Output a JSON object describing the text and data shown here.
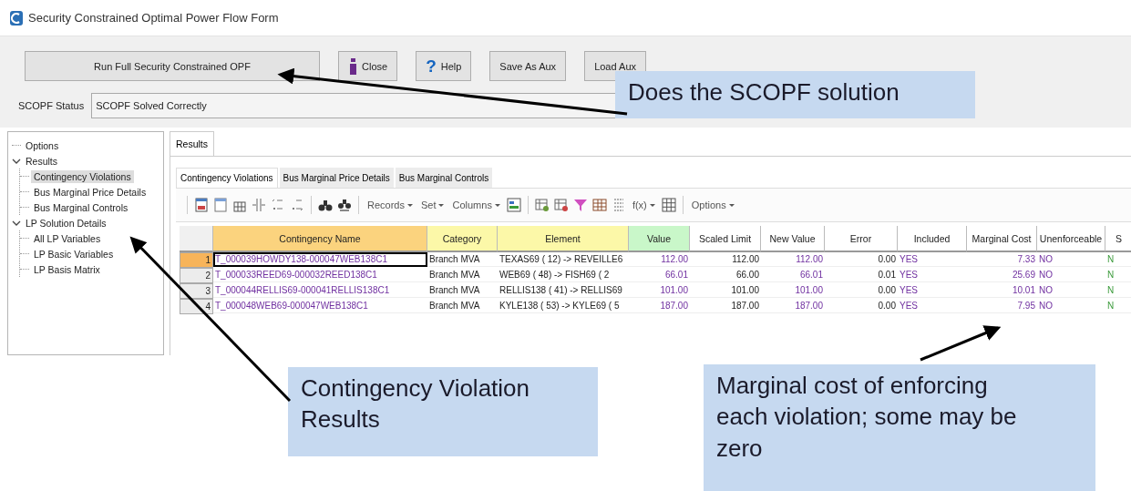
{
  "window": {
    "title": "Security Constrained Optimal Power Flow Form"
  },
  "command_bar": {
    "buttons": [
      {
        "label": "Run Full Security Constrained OPF",
        "kind": "wide"
      },
      {
        "label": "Close",
        "kind": "info"
      },
      {
        "label": "Help",
        "kind": "help",
        "glyph": "?"
      },
      {
        "label": "Save As Aux",
        "kind": "plain"
      },
      {
        "label": "Load Aux",
        "kind": "plain"
      }
    ],
    "status": {
      "label": "SCOPF Status",
      "value": "SCOPF Solved Correctly"
    }
  },
  "tree": {
    "items": [
      {
        "label": "Options",
        "selected": false
      },
      {
        "label": "Results",
        "selected": false,
        "expanded": true,
        "children": [
          {
            "label": "Contingency Violations",
            "selected": true
          },
          {
            "label": "Bus Marginal Price Details",
            "selected": false
          },
          {
            "label": "Bus Marginal Controls",
            "selected": false
          }
        ]
      },
      {
        "label": "LP Solution Details",
        "selected": false,
        "expanded": true,
        "children": [
          {
            "label": "All LP Variables",
            "selected": false
          },
          {
            "label": "LP Basic Variables",
            "selected": false
          },
          {
            "label": "LP Basis Matrix",
            "selected": false
          }
        ]
      }
    ]
  },
  "results": {
    "tabs": [
      {
        "label": "Results",
        "selected": true
      }
    ],
    "sub_tabs": [
      {
        "label": "Contingency Violations",
        "selected": true
      },
      {
        "label": "Bus Marginal Price Details",
        "selected": false
      },
      {
        "label": "Bus Marginal Controls",
        "selected": false
      }
    ],
    "toolbar": {
      "menus": [
        {
          "label": "Records"
        },
        {
          "label": "Set"
        },
        {
          "label": "Columns"
        }
      ],
      "formula_menu": {
        "label": "f(x)"
      },
      "options_menu": {
        "label": "Options"
      }
    },
    "table": {
      "columns": [
        {
          "kind": "index",
          "color": "#f0f0f0"
        },
        {
          "label": "Contingency Name",
          "kind": "name",
          "color": "#fbd37e"
        },
        {
          "label": "Category",
          "kind": "label",
          "color": "#fcf8a8"
        },
        {
          "label": "Element",
          "kind": "label",
          "color": "#fcf8a8"
        },
        {
          "label": "Value",
          "kind": "value",
          "color": "#c9f7c9"
        },
        {
          "label": "Scaled Limit",
          "kind": "number",
          "color": "#ffffff"
        },
        {
          "label": "New Value",
          "kind": "value",
          "color": "#ffffff"
        },
        {
          "label": "Error",
          "kind": "number",
          "color": "#ffffff"
        },
        {
          "label": "Included",
          "kind": "flag",
          "color": "#ffffff"
        },
        {
          "label": "Marginal Cost",
          "kind": "value",
          "color": "#ffffff"
        },
        {
          "label": "Unenforceable",
          "kind": "flag",
          "color": "#ffffff"
        },
        {
          "label": "S",
          "kind": "status",
          "color": "#ffffff"
        }
      ],
      "rows": [
        {
          "selected": true,
          "cells": [
            "1",
            "T_000039HOWDY138-000047WEB138C1",
            "Branch MVA",
            "TEXAS69 ( 12) -> REVEILLE6",
            "112.00",
            "112.00",
            "112.00",
            "0.00",
            "YES",
            "7.33",
            "NO",
            "N"
          ]
        },
        {
          "selected": false,
          "cells": [
            "2",
            "T_000033REED69-000032REED138C1",
            "Branch MVA",
            "WEB69 ( 48) -> FISH69 ( 2",
            "66.01",
            "66.00",
            "66.01",
            "0.01",
            "YES",
            "25.69",
            "NO",
            "N"
          ]
        },
        {
          "selected": false,
          "cells": [
            "3",
            "T_000044RELLIS69-000041RELLIS138C1",
            "Branch MVA",
            "RELLIS138 ( 41) -> RELLIS69",
            "101.00",
            "101.00",
            "101.00",
            "0.00",
            "YES",
            "10.01",
            "NO",
            "N"
          ]
        },
        {
          "selected": false,
          "cells": [
            "4",
            "T_000048WEB69-000047WEB138C1",
            "Branch MVA",
            "KYLE138 ( 53) -> KYLE69 ( 5",
            "187.00",
            "187.00",
            "187.00",
            "0.00",
            "YES",
            "7.95",
            "NO",
            "N"
          ]
        }
      ]
    }
  },
  "callouts": [
    {
      "text": "Does the SCOPF solution"
    },
    {
      "text": "Contingency Violation Results"
    },
    {
      "text": "Marginal cost of enforcing each violation; some may be zero"
    }
  ]
}
